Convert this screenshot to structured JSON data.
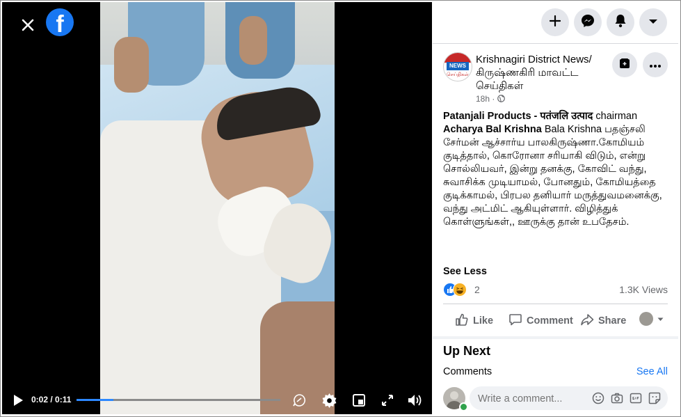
{
  "video": {
    "time_display": "0:02 / 0:11",
    "progress_fraction": 0.18
  },
  "post": {
    "page_name": "Krishnagiri District News/ கிருஷ்ணகிரி மாவட்ட செய்திகள்",
    "time": "18h",
    "avatar_text_top": "NEWS",
    "avatar_text_bottom": "செய்திகள்",
    "text_line1_bold": "Patanjali Products - पतंजलि उत्पाद",
    "text_line1_rest": " chairman",
    "text_line2_bold": "Acharya Bal Krishna",
    "text_line2_rest": " Bala Krishna பதஞ்சலி சேர்மன் ஆச்சார்ய பாலகிருஷ்ணா.கோமியம் குடித்தால், கொரோனா சரியாகி விடும், என்று சொல்லியவர், இன்று தனக்கு, கோவிட் வந்து, சுவாசிக்க முடியாமல், போனதும், கோமியத்தை குடிக்காமல், பிரபல தனியார் மருத்துவமனைக்கு, வந்து அட்மிட் ஆகியுள்ளார். விழித்துக் கொள்ளுங்கள்,, ஊருக்கு தான் உபதேசம்.",
    "see_less": "See Less",
    "reaction_count": "2",
    "views": "1.3K Views"
  },
  "actions": {
    "like": "Like",
    "comment": "Comment",
    "share": "Share"
  },
  "up_next": {
    "title": "Up Next",
    "comments_label": "Comments",
    "see_all": "See All"
  },
  "composer": {
    "placeholder": "Write a comment..."
  },
  "colors": {
    "brand": "#1877f2",
    "progress": "#2d88ff",
    "online": "#31a24c"
  },
  "icons": [
    "close-icon",
    "facebook-logo-icon",
    "plus-icon",
    "messenger-icon",
    "bell-icon",
    "caret-down-icon",
    "save-icon",
    "more-icon",
    "play-icon",
    "captions-icon",
    "gear-icon",
    "miniplayer-icon",
    "fullscreen-icon",
    "volume-icon",
    "like-icon",
    "comment-icon",
    "share-icon",
    "emoji-icon",
    "camera-icon",
    "gif-icon",
    "sticker-icon"
  ]
}
